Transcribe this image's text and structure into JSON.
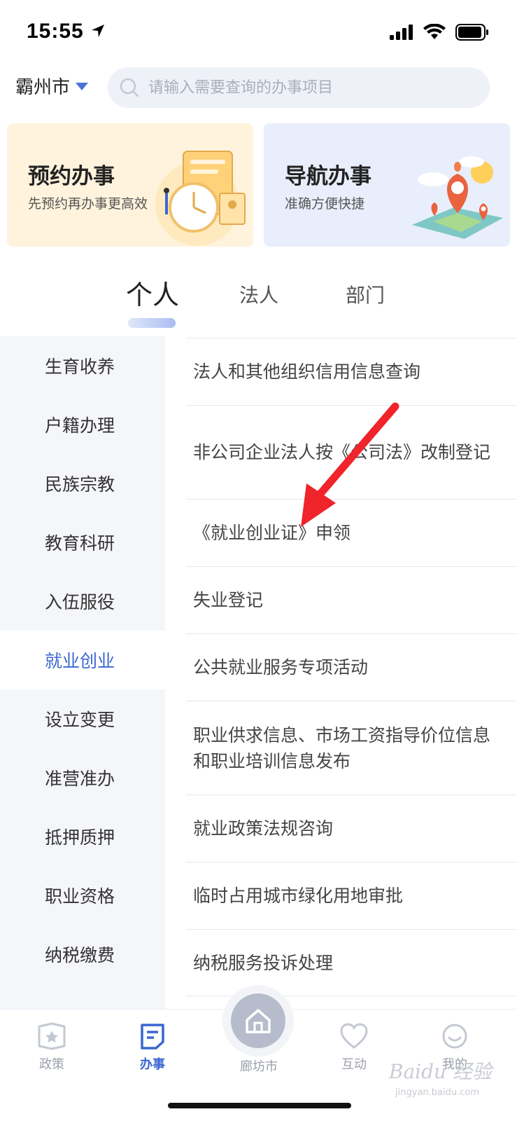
{
  "status_bar": {
    "time": "15:55"
  },
  "header": {
    "city": "霸州市",
    "search_placeholder": "请输入需要查询的办事项目"
  },
  "banners": [
    {
      "title": "预约办事",
      "subtitle": "先预约再办事更高效"
    },
    {
      "title": "导航办事",
      "subtitle": "准确方便快捷"
    }
  ],
  "tabs": [
    {
      "label": "个人",
      "active": true
    },
    {
      "label": "法人",
      "active": false
    },
    {
      "label": "部门",
      "active": false
    }
  ],
  "sidebar": {
    "items": [
      {
        "label": "生育收养"
      },
      {
        "label": "户籍办理"
      },
      {
        "label": "民族宗教"
      },
      {
        "label": "教育科研"
      },
      {
        "label": "入伍服役"
      },
      {
        "label": "就业创业",
        "active": true
      },
      {
        "label": "设立变更"
      },
      {
        "label": "准营准办"
      },
      {
        "label": "抵押质押"
      },
      {
        "label": "职业资格"
      },
      {
        "label": "纳税缴费"
      }
    ]
  },
  "list": {
    "items": [
      {
        "label": "法人和其他组织信用信息查询"
      },
      {
        "label": "非公司企业法人按《公司法》改制登记"
      },
      {
        "label": "《就业创业证》申领"
      },
      {
        "label": "失业登记"
      },
      {
        "label": "公共就业服务专项活动"
      },
      {
        "label": "职业供求信息、市场工资指导价位信息和职业培训信息发布"
      },
      {
        "label": "就业政策法规咨询"
      },
      {
        "label": "临时占用城市绿化用地审批"
      },
      {
        "label": "纳税服务投诉处理"
      }
    ]
  },
  "bottom_nav": {
    "items": [
      {
        "label": "政策",
        "icon": "policy-icon"
      },
      {
        "label": "办事",
        "icon": "affairs-icon",
        "active": true
      },
      {
        "label": "廊坊市",
        "icon": "home-icon"
      },
      {
        "label": "互动",
        "icon": "heart-icon"
      },
      {
        "label": "我的",
        "icon": "smile-icon"
      }
    ]
  },
  "watermark": {
    "text": "Baidu 经验",
    "sub": "jingyan.baidu.com"
  },
  "colors": {
    "accent": "#3a66d0",
    "annotation_arrow": "#f0242b"
  }
}
